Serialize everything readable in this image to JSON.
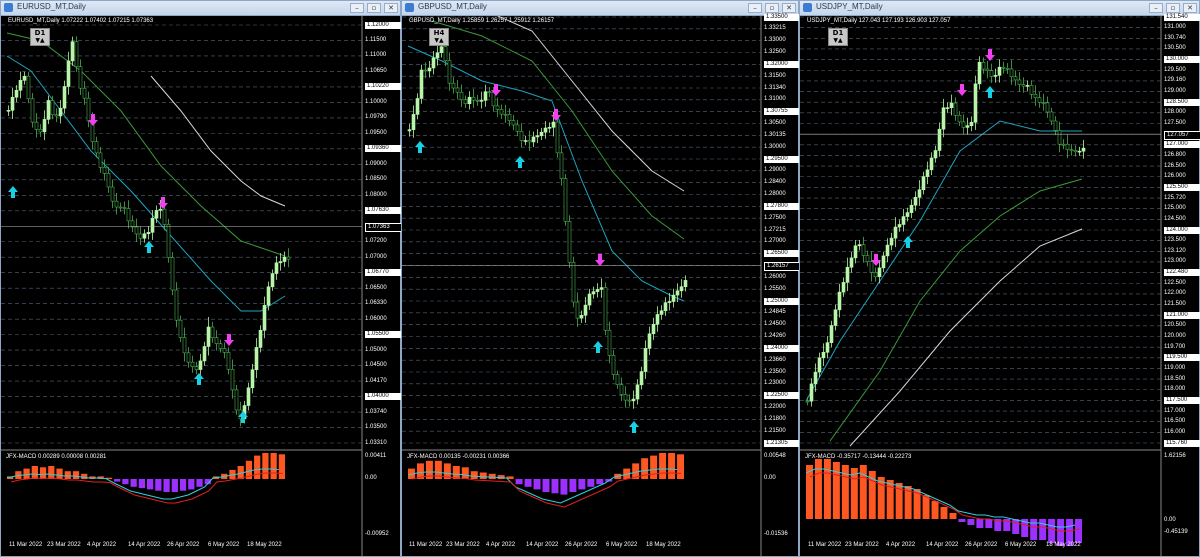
{
  "colors": {
    "bull": "#b7f5a9",
    "bear": "#4caf50",
    "up_arrow": "#17d0e6",
    "down_arrow": "#f040f0",
    "grid": "#556677",
    "ma_fast": "#1ea3c0",
    "ma_mid": "#3a9a3a",
    "ma_slow": "#d8d8d8",
    "macd_pos": "#ff5722",
    "macd_neg": "#9b30ff",
    "macd_line": "#2ad2e0",
    "signal_line": "#e02020"
  },
  "charts": [
    {
      "window_title": "EURUSD_MT,Daily",
      "info": "EURUSD_MT,Daily  1.07222 1.07402 1.07215 1.07363",
      "timeframe": "D1",
      "price_labels": [
        "1.12000",
        "1.11500",
        "1.11000",
        "1.10650",
        "1.10220",
        "1.10000",
        "1.09790",
        "1.09500",
        "1.09360",
        "1.09000",
        "1.08500",
        "1.08000",
        "1.07630",
        "1.07363",
        "1.07200",
        "1.07000",
        "1.06770",
        "1.06500",
        "1.06330",
        "1.06000",
        "1.05500",
        "1.05000",
        "1.04500",
        "1.04170",
        "1.04000",
        "1.03740",
        "1.03500",
        "1.03310"
      ],
      "macd_info": "JFX-MACD 0.00289 0.00008 0.00281",
      "macd_labels": [
        "0.00411",
        "0.00",
        "-0.00952"
      ],
      "dates": [
        "11 Mar 2022",
        "23 Mar 2022",
        "4 Apr 2022",
        "14 Apr 2022",
        "26 Apr 2022",
        "6 May 2022",
        "18 May 2022"
      ],
      "window_buttons": {
        "min": "–",
        "max": "▫",
        "close": "✕"
      }
    },
    {
      "window_title": "GBPUSD_MT,Daily",
      "info": "GBPUSD_MT,Daily  1.25859 1.26257 1.25912 1.26157",
      "timeframe": "H4",
      "price_labels": [
        "1.33500",
        "1.33215",
        "1.33000",
        "1.32500",
        "1.32000",
        "1.31500",
        "1.31340",
        "1.31000",
        "1.30755",
        "1.30500",
        "1.30135",
        "1.30000",
        "1.29500",
        "1.29000",
        "1.28400",
        "1.28000",
        "1.27800",
        "1.27500",
        "1.27215",
        "1.27000",
        "1.26500",
        "1.26157",
        "1.26000",
        "1.25500",
        "1.25000",
        "1.24845",
        "1.24500",
        "1.24260",
        "1.24000",
        "1.23660",
        "1.23500",
        "1.23000",
        "1.22500",
        "1.22000",
        "1.21800",
        "1.21500",
        "1.21305"
      ],
      "macd_info": "JFX-MACD 0.00135 -0.00231 0.00366",
      "macd_labels": [
        "0.00548",
        "0.00",
        "-0.01536"
      ],
      "dates": [
        "11 Mar 2022",
        "23 Mar 2022",
        "4 Apr 2022",
        "14 Apr 2022",
        "26 Apr 2022",
        "6 May 2022",
        "18 May 2022"
      ],
      "window_buttons": {
        "min": "–",
        "max": "▫",
        "close": "✕"
      }
    },
    {
      "window_title": "USDJPY_MT,Daily",
      "info": "USDJPY_MT,Daily  127.043 127.193 126.903 127.057",
      "timeframe": "D1",
      "price_labels": [
        "131.540",
        "131.000",
        "130.740",
        "130.500",
        "130.000",
        "129.500",
        "129.160",
        "129.000",
        "128.500",
        "128.000",
        "127.500",
        "127.057",
        "127.000",
        "126.800",
        "126.500",
        "126.000",
        "125.500",
        "125.720",
        "125.000",
        "124.500",
        "124.000",
        "123.500",
        "123.120",
        "123.000",
        "122.480",
        "122.500",
        "122.000",
        "121.500",
        "121.000",
        "120.500",
        "120.000",
        "119.700",
        "119.500",
        "119.000",
        "118.500",
        "118.000",
        "117.500",
        "117.000",
        "116.500",
        "116.000",
        "115.760"
      ],
      "macd_info": "JFX-MACD -0.35717 -0.13444 -0.22273",
      "macd_labels": [
        "1.62156",
        "0.00",
        "-0.45139"
      ],
      "dates": [
        "11 Mar 2022",
        "23 Mar 2022",
        "4 Apr 2022",
        "14 Apr 2022",
        "26 Apr 2022",
        "6 May 2022",
        "18 May 2022"
      ],
      "window_buttons": {
        "min": "–",
        "max": "▫",
        "close": "✕"
      }
    }
  ]
}
